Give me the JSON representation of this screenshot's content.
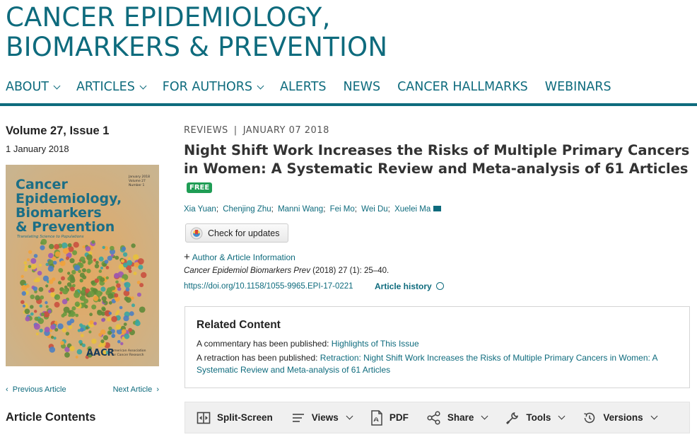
{
  "journal": {
    "title_line1": "CANCER EPIDEMIOLOGY,",
    "title_line2": "BIOMARKERS & PREVENTION"
  },
  "nav": {
    "items": [
      {
        "label": "ABOUT",
        "dropdown": true
      },
      {
        "label": "ARTICLES",
        "dropdown": true
      },
      {
        "label": "FOR AUTHORS",
        "dropdown": true
      },
      {
        "label": "ALERTS",
        "dropdown": false
      },
      {
        "label": "NEWS",
        "dropdown": false
      },
      {
        "label": "CANCER HALLMARKS",
        "dropdown": false
      },
      {
        "label": "WEBINARS",
        "dropdown": false
      }
    ]
  },
  "sidebar": {
    "volume": "Volume 27, Issue 1",
    "date": "1 January 2018",
    "cover": {
      "title_line1": "Cancer",
      "title_line2": "Epidemiology,",
      "title_line3": "Biomarkers",
      "title_line4": "& Prevention",
      "tagline": "Translating Science to Populations",
      "issue_line1": "January 2018",
      "issue_line2": "Volume 27",
      "issue_line3": "Number 1",
      "publisher_logo": "AACR",
      "publisher_name_line1": "American Association",
      "publisher_name_line2": "for Cancer Research"
    },
    "prev_label": "Previous Article",
    "next_label": "Next Article",
    "contents_heading": "Article Contents"
  },
  "article": {
    "section": "REVIEWS",
    "separator": "|",
    "date": "JANUARY 07 2018",
    "title": "Night Shift Work Increases the Risks of Multiple Primary Cancers in Women: A Systematic Review and Meta-analysis of 61 Articles",
    "free_badge": "FREE",
    "authors": [
      "Xia Yuan",
      "Chenjing Zhu",
      "Manni Wang",
      "Fei Mo",
      "Wei Du",
      "Xuelei Ma"
    ],
    "check_updates_label": "Check for updates",
    "author_info_label": "Author & Article Information",
    "citation_journal": "Cancer Epidemiol Biomarkers Prev",
    "citation_rest": " (2018) 27 (1): 25–40.",
    "doi": "https://doi.org/10.1158/1055-9965.EPI-17-0221",
    "history_label": "Article history"
  },
  "related": {
    "heading": "Related Content",
    "commentary_prefix": "A commentary has been published: ",
    "commentary_link": "Highlights of This Issue",
    "retraction_prefix": "A retraction has been published: ",
    "retraction_link": "Retraction: Night Shift Work Increases the Risks of Multiple Primary Cancers in Women: A Systematic Review and Meta-analysis of 61 Articles"
  },
  "toolbar": {
    "split_screen": "Split-Screen",
    "views": "Views",
    "pdf": "PDF",
    "share": "Share",
    "tools": "Tools",
    "versions": "Versions"
  },
  "colors": {
    "brand": "#0e6b7d",
    "free_badge": "#1f9d55"
  }
}
